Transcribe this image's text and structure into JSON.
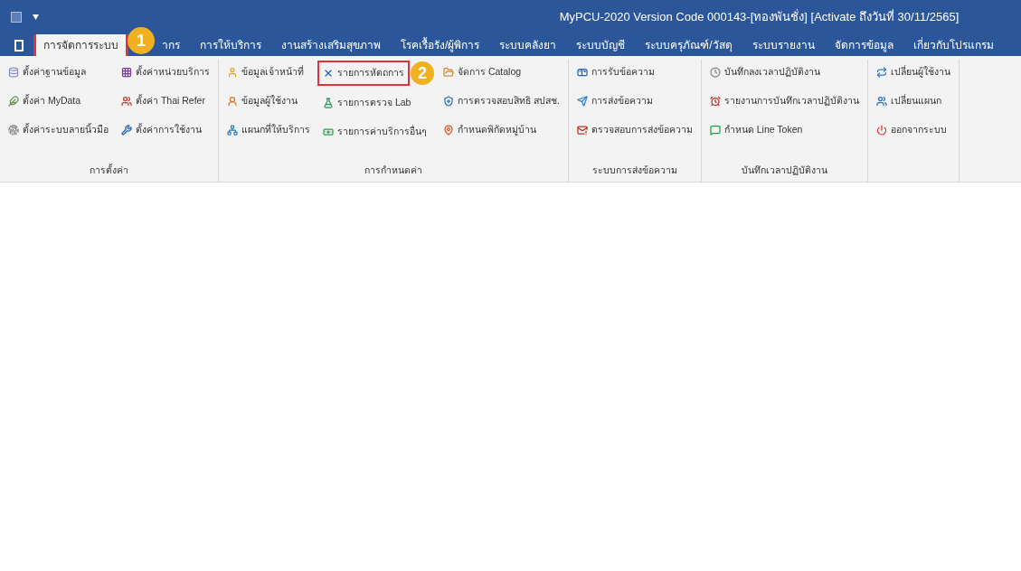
{
  "window": {
    "title": "MyPCU-2020 Version Code 000143-[ทองพันชั่ง] [Activate ถึงวันที่ 30/11/2565]"
  },
  "tabs": [
    {
      "label": "การจัดการระบบ",
      "selected": true,
      "callout": "1"
    },
    {
      "label": "ากร",
      "selected": false
    },
    {
      "label": "การให้บริการ",
      "selected": false
    },
    {
      "label": "งานสร้างเสริมสุขภาพ",
      "selected": false
    },
    {
      "label": "โรคเรื้อรัง/ผู้พิการ",
      "selected": false
    },
    {
      "label": "ระบบคลังยา",
      "selected": false
    },
    {
      "label": "ระบบบัญชี",
      "selected": false
    },
    {
      "label": "ระบบครุภัณฑ์/วัสดุ",
      "selected": false
    },
    {
      "label": "ระบบรายงาน",
      "selected": false
    },
    {
      "label": "จัดการข้อมูล",
      "selected": false
    },
    {
      "label": "เกี่ยวกับโปรแกรม",
      "selected": false
    }
  ],
  "ribbon_groups": [
    {
      "label": "การตั้งค่า",
      "columns": [
        [
          {
            "label": "ตั้งค่าฐานข้อมูล"
          },
          {
            "label": "ตั้งค่า MyData"
          },
          {
            "label": "ตั้งค่าระบบลายนิ้วมือ"
          }
        ],
        [
          {
            "label": "ตั้งค่าหน่วยบริการ"
          },
          {
            "label": "ตั้งค่า Thai Refer"
          },
          {
            "label": "ตั้งค่าการใช้งาน"
          }
        ]
      ]
    },
    {
      "label": "การกำหนดค่า",
      "columns": [
        [
          {
            "label": "ข้อมูลเจ้าหน้าที่"
          },
          {
            "label": "ข้อมูลผู้ใช้งาน"
          },
          {
            "label": "แผนกที่ให้บริการ"
          }
        ],
        [
          {
            "label": "รายการหัตถการ",
            "callout": "2"
          },
          {
            "label": "รายการตรวจ Lab"
          },
          {
            "label": "รายการค่าบริการอื่นๆ"
          }
        ],
        [
          {
            "label": "จัดการ Catalog"
          },
          {
            "label": "การตรวจสอบสิทธิ สปสช."
          },
          {
            "label": "กำหนดพิกัดหมู่บ้าน"
          }
        ]
      ]
    },
    {
      "label": "ระบบการส่งข้อความ",
      "columns": [
        [
          {
            "label": "การรับข้อความ"
          },
          {
            "label": "การส่งข้อความ"
          },
          {
            "label": "ตรวจสอบการส่งข้อความ"
          }
        ]
      ]
    },
    {
      "label": "บันทึกเวลาปฏิบัติงาน",
      "columns": [
        [
          {
            "label": "บันทึกลงเวลาปฏิบัติงาน"
          },
          {
            "label": "รายงานการบันทึกเวลาปฏิบัติงาน"
          },
          {
            "label": "กำหนด Line Token"
          }
        ]
      ]
    },
    {
      "columns": [
        [
          {
            "label": "เปลี่ยนผู้ใช้งาน"
          },
          {
            "label": "เปลี่ยนแผนก"
          },
          {
            "label": "ออกจากระบบ"
          }
        ]
      ]
    }
  ]
}
